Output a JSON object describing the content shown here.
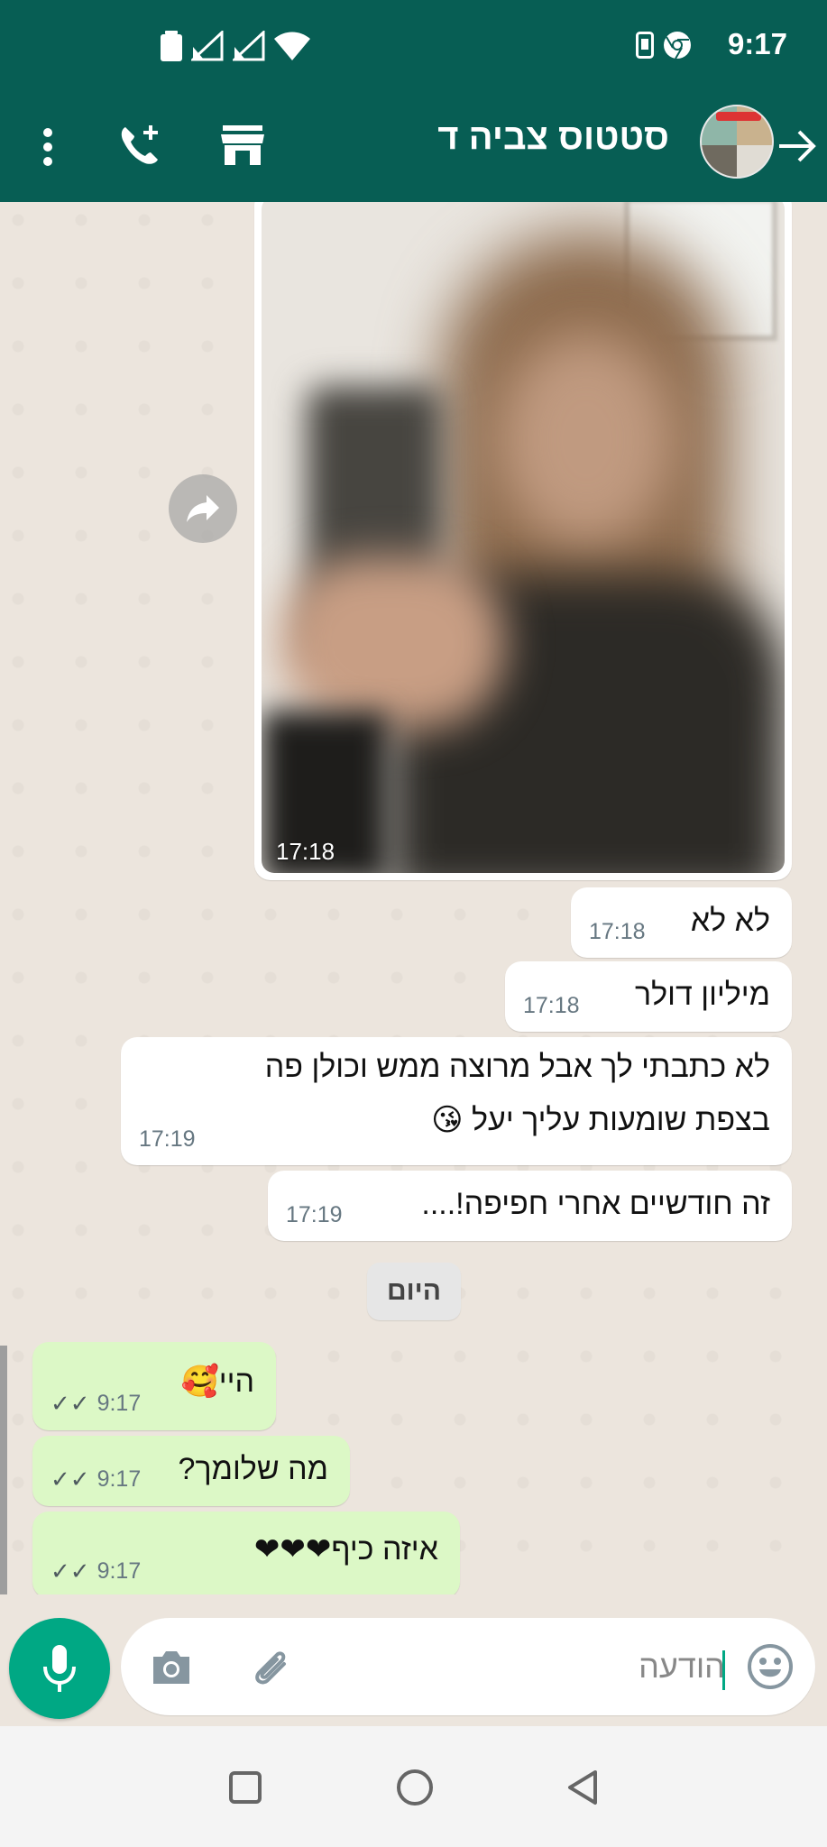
{
  "status_bar": {
    "time": "9:17",
    "left_icons": [
      "battery-icon",
      "signal-icon",
      "signal-icon",
      "wifi-icon"
    ],
    "right_icons": [
      "sim-icon",
      "chrome-icon"
    ]
  },
  "header": {
    "title": "סטטוס צביה ד",
    "icons": [
      "back-arrow-icon",
      "avatar",
      "store-icon",
      "add-call-icon",
      "more-options-icon"
    ]
  },
  "messages": [
    {
      "type": "image",
      "time": "17:18",
      "direction": "in"
    },
    {
      "type": "text",
      "text": "לא לא",
      "time": "17:18",
      "direction": "in"
    },
    {
      "type": "text",
      "text": "מיליון דולר",
      "time": "17:18",
      "direction": "in"
    },
    {
      "type": "text",
      "line1": "לא כתבתי לך אבל מרוצה ממש וכולן פה",
      "line2": "בצפת שומעות עליך יעל 😘",
      "time": "17:19",
      "direction": "in"
    },
    {
      "type": "text",
      "text": "זה חודשיים אחרי חפיפה!....",
      "time": "17:19",
      "direction": "in"
    },
    {
      "type": "date",
      "text": "היום"
    },
    {
      "type": "text",
      "text": "היי🥰",
      "time": "9:17",
      "direction": "out",
      "ticks": "✓✓"
    },
    {
      "type": "text",
      "text": "מה שלומך?",
      "time": "9:17",
      "direction": "out",
      "ticks": "✓✓"
    },
    {
      "type": "text",
      "text": "איזה כיף❤❤❤",
      "time": "9:17",
      "direction": "out",
      "ticks": "✓✓"
    }
  ],
  "composer": {
    "placeholder": "הודעה",
    "icons": [
      "emoji-icon",
      "attach-icon",
      "camera-icon",
      "mic-icon"
    ],
    "accent": "#00a884"
  },
  "colors": {
    "header": "#075e54",
    "incoming": "#ffffff",
    "outgoing": "#dcf8c6",
    "background": "#ece5dd"
  },
  "navbar": {
    "icons": [
      "recents-icon",
      "home-icon",
      "back-icon"
    ]
  }
}
